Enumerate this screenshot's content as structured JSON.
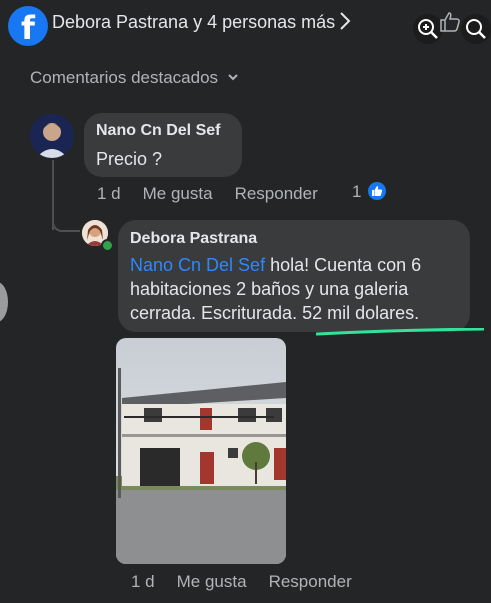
{
  "header": {
    "title": "Debora Pastrana y 4 personas más",
    "logo_letter": "f"
  },
  "sort": {
    "label": "Comentarios destacados"
  },
  "comment1": {
    "author": "Nano Cn Del Sef",
    "text": "Precio ?",
    "time": "1 d",
    "like": "Me gusta",
    "reply": "Responder",
    "reaction_count": "1"
  },
  "comment2": {
    "author": "Debora Pastrana",
    "mention": "Nano Cn Del Sef",
    "line1_rest": " hola! Cuenta con 6",
    "line2": "habitaciones 2 baños y una galeria",
    "line3": "cerrada. Escriturada. 52 mil dolares.",
    "time": "1 d",
    "like": "Me gusta",
    "reply": "Responder"
  },
  "colors": {
    "background": "#242526",
    "bubble": "#3a3b3c",
    "link": "#2d88ff",
    "brand": "#1877f2",
    "highlight": "#35e29a"
  }
}
